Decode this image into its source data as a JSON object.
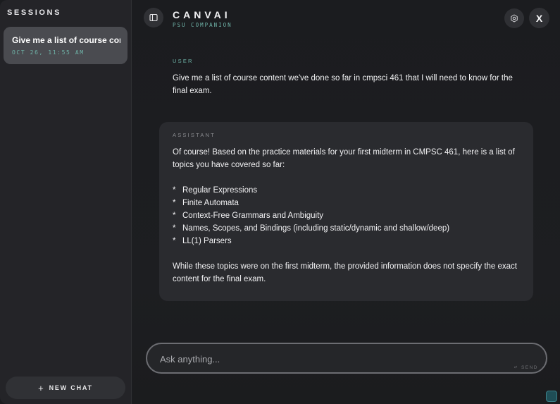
{
  "sidebar": {
    "title": "SESSIONS",
    "sessions": [
      {
        "title": "Give me a list of course con...",
        "time": "OCT 26, 11:55 AM"
      }
    ],
    "new_chat_label": "NEW CHAT",
    "new_chat_icon": "+"
  },
  "header": {
    "title": "CANVAI",
    "subtitle": "PSU COMPANION",
    "close_label": "X"
  },
  "messages": {
    "user": {
      "role": "USER",
      "text": "Give me a list of course content we've done so far in cmpsci 461 that I will need to know for the final exam."
    },
    "assistant": {
      "role": "ASSISTANT",
      "intro": "Of course! Based on the practice materials for your first midterm in CMPSC 461, here is a list of topics you have covered so far:",
      "bullets": [
        "Regular Expressions",
        "Finite Automata",
        "Context-Free Grammars and Ambiguity",
        "Names, Scopes, and Bindings (including static/dynamic and shallow/deep)",
        "LL(1) Parsers"
      ],
      "outro": "While these topics were on the first midterm, the provided information does not specify the exact content for the final exam."
    }
  },
  "input": {
    "placeholder": "Ask anything...",
    "value": "",
    "send_label": "↵ SEND"
  },
  "icons": {
    "sidebar_toggle": "sidebar-panel-icon",
    "settings": "gear-icon",
    "close": "close-icon"
  },
  "colors": {
    "accent": "#6fb3a8",
    "session_active": "#4a4b50",
    "assistant_bubble": "#2a2b2f"
  }
}
